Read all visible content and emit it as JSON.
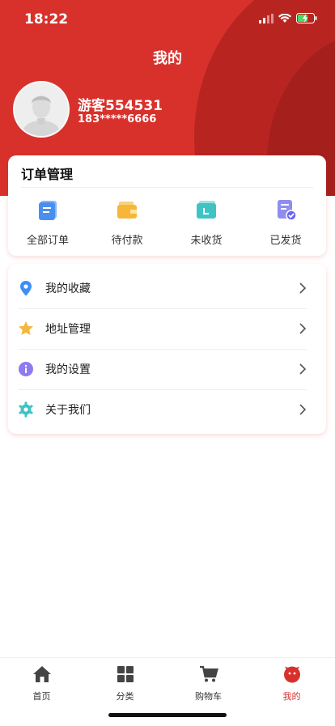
{
  "status": {
    "time": "18:22"
  },
  "header": {
    "title": "我的"
  },
  "user": {
    "name": "游客554531",
    "phone": "183*****6666"
  },
  "orders": {
    "heading": "订单管理",
    "items": [
      {
        "label": "全部订单",
        "icon": "all-orders-icon"
      },
      {
        "label": "待付款",
        "icon": "wallet-icon"
      },
      {
        "label": "未收货",
        "icon": "package-icon"
      },
      {
        "label": "已发货",
        "icon": "shipped-icon"
      }
    ]
  },
  "menu": {
    "items": [
      {
        "label": "我的收藏",
        "icon": "location-pin-icon"
      },
      {
        "label": "地址管理",
        "icon": "star-icon"
      },
      {
        "label": "我的设置",
        "icon": "info-icon"
      },
      {
        "label": "关于我们",
        "icon": "gear-icon"
      }
    ]
  },
  "tabbar": {
    "items": [
      {
        "label": "首页",
        "icon": "home-icon"
      },
      {
        "label": "分类",
        "icon": "grid-icon"
      },
      {
        "label": "购物车",
        "icon": "cart-icon"
      },
      {
        "label": "我的",
        "icon": "profile-icon"
      }
    ],
    "active": "我的"
  },
  "colors": {
    "brand": "#d8312b",
    "brand_dark": "#a51f1c"
  }
}
